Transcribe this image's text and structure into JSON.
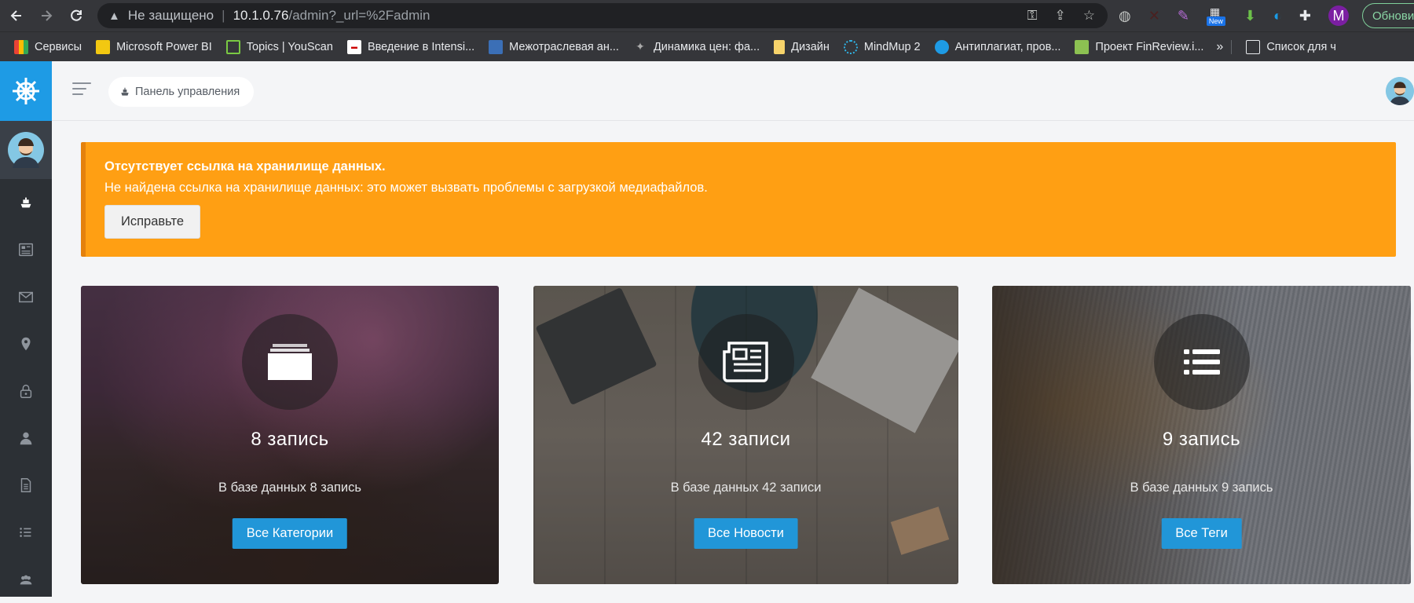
{
  "browser": {
    "security_label": "Не защищено",
    "url_host": "10.1.0.76",
    "url_path": "/admin?_url=%2Fadmin",
    "profile_initial": "M",
    "update_label": "Обнови",
    "ext_new_badge": "New",
    "bookmarks": [
      {
        "label": "Сервисы"
      },
      {
        "label": "Microsoft Power BI"
      },
      {
        "label": "Topics | YouScan"
      },
      {
        "label": "Введение в Intensi..."
      },
      {
        "label": "Межотраслевая ан..."
      },
      {
        "label": "Динамика цен: фа..."
      },
      {
        "label": "Дизайн"
      },
      {
        "label": "MindMup 2"
      },
      {
        "label": "Антиплагиат, пров..."
      },
      {
        "label": "Проект FinReview.i..."
      }
    ],
    "bookmarks_more": "»",
    "reading_list": "Список для ч"
  },
  "header": {
    "breadcrumb": "Панель управления"
  },
  "alert": {
    "title": "Отсутствует ссылка на хранилище данных.",
    "text": "Не найдена ссылка на хранилище данных: это может вызвать проблемы с загрузкой медиафайлов.",
    "button": "Исправьте"
  },
  "cards": [
    {
      "count": "8 запись",
      "subtitle": "В базе данных 8 запись",
      "button": "Все Категории",
      "icon": "folder-icon"
    },
    {
      "count": "42 записи",
      "subtitle": "В базе данных 42 записи",
      "button": "Все Новости",
      "icon": "newspaper-icon"
    },
    {
      "count": "9 запись",
      "subtitle": "В базе данных 9 запись",
      "button": "Все Теги",
      "icon": "list-icon"
    }
  ],
  "colors": {
    "alert_bg": "#ff9f13",
    "primary_button": "#2196d8",
    "sidebar_bg": "#2c3035",
    "logo_bg": "#1e9be5"
  }
}
